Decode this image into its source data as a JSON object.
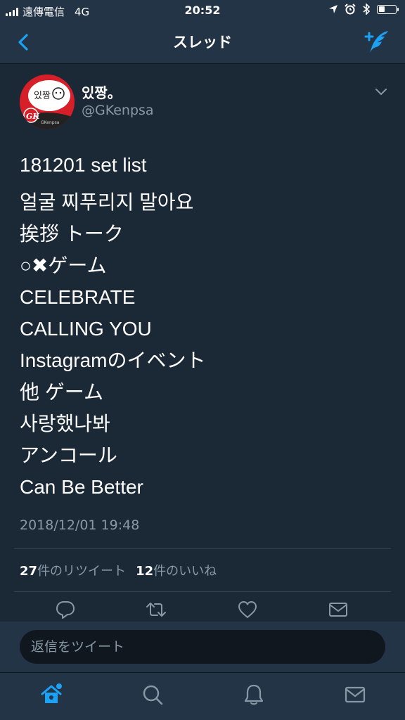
{
  "status_bar": {
    "carrier": "遠傳電信",
    "network": "4G",
    "time": "20:52",
    "battery_level": 0.35
  },
  "nav": {
    "title": "スレッド",
    "back_icon": "chevron-left-icon",
    "compose_icon": "compose-tweet-icon"
  },
  "tweet": {
    "author_name": "있짱。",
    "author_handle": "@GKenpsa",
    "avatar_text": "GK",
    "avatar_subtext": "GKenpsa",
    "lines": [
      "181201 set list",
      "얼굴 찌푸리지 말아요",
      "挨拶 トーク",
      "○✖ゲーム",
      "CELEBRATE",
      "CALLING YOU",
      "Instagramのイベント",
      "他 ゲーム",
      "사랑했나봐",
      "アンコール",
      "Can Be Better"
    ],
    "timestamp": "2018/12/01 19:48",
    "retweet_count": "27",
    "retweet_label": "件のリツイート",
    "like_count": "12",
    "like_label": "件のいいね"
  },
  "reply": {
    "placeholder": "返信をツイート"
  },
  "colors": {
    "background": "#1b2836",
    "bar": "#243447",
    "accent": "#1da1f2",
    "muted": "#8899a6"
  }
}
